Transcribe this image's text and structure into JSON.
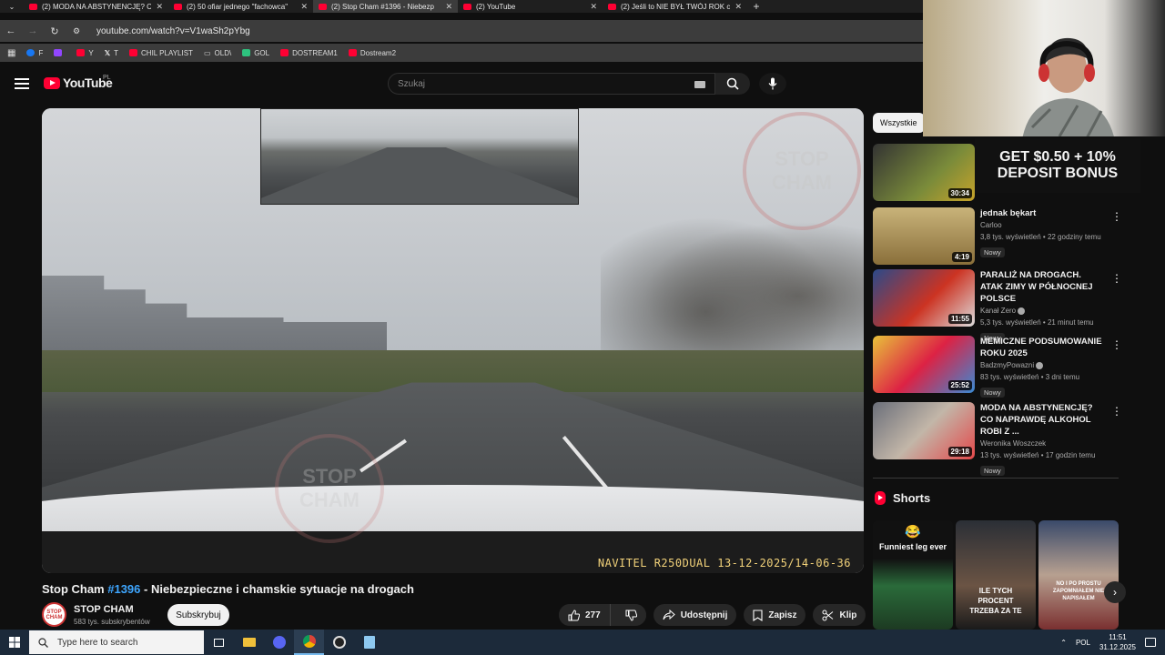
{
  "browser": {
    "tabs": [
      {
        "title": "(2) MODA NA ABSTYNENCJĘ? C",
        "active": false
      },
      {
        "title": "(2) 50 ofiar jednego \"fachowca\"",
        "active": false
      },
      {
        "title": "(2) Stop Cham #1396 - Niebezp",
        "active": true
      },
      {
        "title": "(2) YouTube",
        "active": false
      },
      {
        "title": "(2) Jeśli to NIE BYŁ TWÓJ ROK c",
        "active": false
      }
    ],
    "new_tab": "+",
    "url": "youtube.com/watch?v=V1waSh2pYbg",
    "bookmarks": [
      {
        "label": "F",
        "color": "#1877f2"
      },
      {
        "label": "",
        "color": "#9146ff"
      },
      {
        "label": "Y",
        "color": "#ff0033"
      },
      {
        "label": "T",
        "color": "#ffffff"
      },
      {
        "label": "CHIL PLAYLIST",
        "color": "#ff0033"
      },
      {
        "label": "OLD\\",
        "color": "#cccccc"
      },
      {
        "label": "GOL",
        "color": "#2ec27e"
      },
      {
        "label": "DOSTREAM1",
        "color": "#ff0033"
      },
      {
        "label": "Dostream2",
        "color": "#ff0033"
      }
    ]
  },
  "youtube": {
    "logo_text": "YouTube",
    "country": "PL",
    "search_placeholder": "Szukaj"
  },
  "video": {
    "title_prefix": "Stop Cham ",
    "title_tag": "#1396",
    "title_rest": " - Niebezpieczne i chamskie sytuacje na drogach",
    "watermark": "STOP\nCHAM",
    "stamp": "NAVITEL R250DUAL 13-12-2025/14-06-36",
    "channel": "STOP CHAM",
    "channel_avatar": "STOP\nCHAM",
    "subs": "583 tys. subskrybentów",
    "subscribe": "Subskrybuj",
    "likes": "277",
    "share": "Udostępnij",
    "save": "Zapisz",
    "clip": "Klip"
  },
  "sidebar": {
    "chip": "Wszystkie",
    "ad": {
      "duration": "30:34",
      "banner_line1": "GET $0.50 + 10%",
      "banner_line2": "DEPOSIT BONUS"
    },
    "recommendations": [
      {
        "title": "jednak bękart",
        "channel": "Carloo",
        "meta": "3,8 tys. wyświetleń • 22 godziny temu",
        "badge": "Nowy",
        "duration": "4:19",
        "verified": false
      },
      {
        "title": "PARALIŻ NA DROGACH. ATAK ZIMY W PÓŁNOCNEJ POLSCE",
        "channel": "Kanał Zero",
        "meta": "5,3 tys. wyświetleń • 21 minut temu",
        "badge": "Nowy",
        "duration": "11:55",
        "verified": true
      },
      {
        "title": "MEMICZNE PODSUMOWANIE ROKU 2025",
        "channel": "BadzmyPowazni",
        "meta": "83 tys. wyświetleń • 3 dni temu",
        "badge": "Nowy",
        "duration": "25:52",
        "verified": true
      },
      {
        "title": "MODA NA ABSTYNENCJĘ? CO NAPRAWDĘ ALKOHOL ROBI Z ...",
        "channel": "Weronika Woszczek",
        "meta": "13 tys. wyświetleń • 17 godzin temu",
        "badge": "Nowy",
        "duration": "29:18",
        "verified": false
      }
    ],
    "shorts_heading": "Shorts",
    "shorts": [
      {
        "caption": "Funniest leg ever",
        "emoji": "😂"
      },
      {
        "caption": "ILE TYCH PROCENT TRZEBA ZA TE"
      },
      {
        "caption": "NO I PO PROSTU ZAPOMNIAŁEM NIE NAPISAŁEM"
      }
    ]
  },
  "taskbar": {
    "search_placeholder": "Type here to search",
    "lang": "POL",
    "time": "11:51",
    "date": "31.12.2025"
  }
}
